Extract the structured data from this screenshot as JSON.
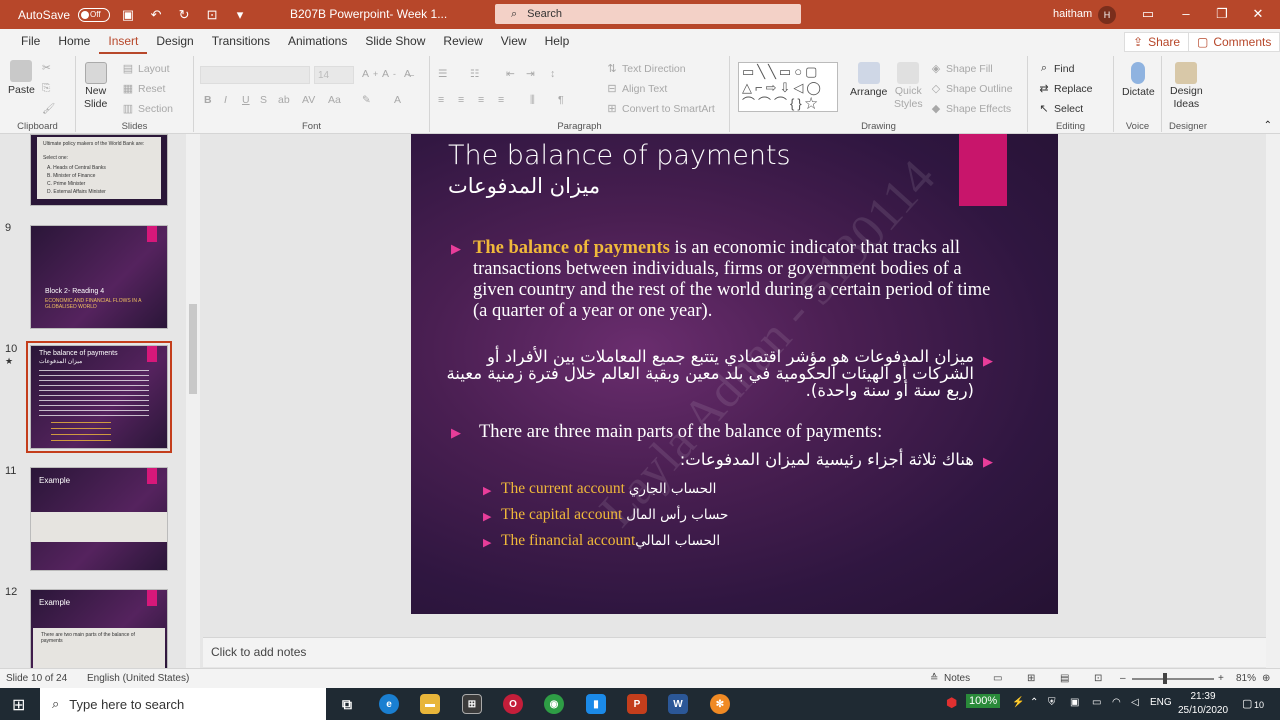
{
  "titlebar": {
    "autosave_label": "AutoSave",
    "autosave_state": "Off",
    "doc_title": "B207B Powerpoint- Week 1...",
    "search_placeholder": "Search",
    "user_name": "haitham",
    "user_initial": "H"
  },
  "tabs": [
    "File",
    "Home",
    "Insert",
    "Design",
    "Transitions",
    "Animations",
    "Slide Show",
    "Review",
    "View",
    "Help"
  ],
  "active_tab": "Insert",
  "share_label": "Share",
  "comments_label": "Comments",
  "ribbon": {
    "clipboard": {
      "paste": "Paste",
      "label": "Clipboard"
    },
    "slides": {
      "new_slide_1": "New",
      "new_slide_2": "Slide",
      "layout": "Layout",
      "reset": "Reset",
      "section": "Section",
      "label": "Slides"
    },
    "font": {
      "size": "14",
      "label": "Font"
    },
    "paragraph": {
      "text_direction": "Text Direction",
      "align_text": "Align Text",
      "smartart": "Convert to SmartArt",
      "label": "Paragraph"
    },
    "drawing": {
      "arrange": "Arrange",
      "quick_styles_1": "Quick",
      "quick_styles_2": "Styles",
      "shape_fill": "Shape Fill",
      "shape_outline": "Shape Outline",
      "shape_effects": "Shape Effects",
      "label": "Drawing"
    },
    "editing": {
      "find": "Find",
      "replace": "Replace",
      "select": "Select",
      "label": "Editing"
    },
    "voice": {
      "dictate": "Dictate",
      "label": "Voice"
    },
    "designer": {
      "design_ideas_1": "Design",
      "design_ideas_2": "Ideas",
      "label": "Designer"
    }
  },
  "thumbnails": [
    {
      "num": "",
      "title": "Ultimate policy makers of the World Bank are:",
      "lines": [
        "Select one:",
        "A. Heads of Central Banks",
        "B. Minister of Finance",
        "C. Prime Minister",
        "D. External Affairs Minister"
      ]
    },
    {
      "num": "9",
      "title": "Block 2- Reading 4",
      "sub": "ECONOMIC AND FINANCIAL FLOWS IN A GLOBALISED WORLD"
    },
    {
      "num": "10",
      "title": "The balance of payments",
      "title_ar": "ميزان المدفوعات"
    },
    {
      "num": "11",
      "title": "Example"
    },
    {
      "num": "12",
      "title": "Example",
      "lines": [
        "There are two main parts of the balance of payments"
      ]
    }
  ],
  "slide": {
    "title": "The balance of payments",
    "title_ar": "ميزان المدفوعات",
    "p1_highlight": "The balance of payments",
    "p1_rest": " is an economic indicator that tracks all transactions between individuals, firms or government bodies of a given country and the rest of the world during a certain period of time (a quarter of a year or one year).",
    "p2_ar": "ميزان المدفوعات هو مؤشر اقتصادي يتتبع جميع المعاملات بين الأفراد أو الشركات أو الهيئات الحكومية في بلد معين وبقية العالم خلال فترة زمنية معينة (ربع سنة أو سنة واحدة).",
    "p3": "There are three main parts of the balance of payments:",
    "p4_ar": "هناك ثلاثة أجزاء رئيسية لميزان المدفوعات:",
    "subs": [
      {
        "en": "The current account",
        "ar": "الحساب الجاري"
      },
      {
        "en": "The capital account",
        "ar": "حساب رأس المال"
      },
      {
        "en": "The financial account",
        "ar": "الحساب المالي"
      }
    ],
    "watermark": "Layla Adnan - 5130114"
  },
  "notes_placeholder": "Click to add notes",
  "statusbar": {
    "slide_info": "Slide 10 of 24",
    "language": "English (United States)",
    "notes": "Notes",
    "zoom": "81%"
  },
  "taskbar": {
    "search_placeholder": "Type here to search",
    "battery": "100%",
    "lang": "ENG",
    "time": "21:39",
    "date": "25/10/2020",
    "notif_count": "10"
  }
}
